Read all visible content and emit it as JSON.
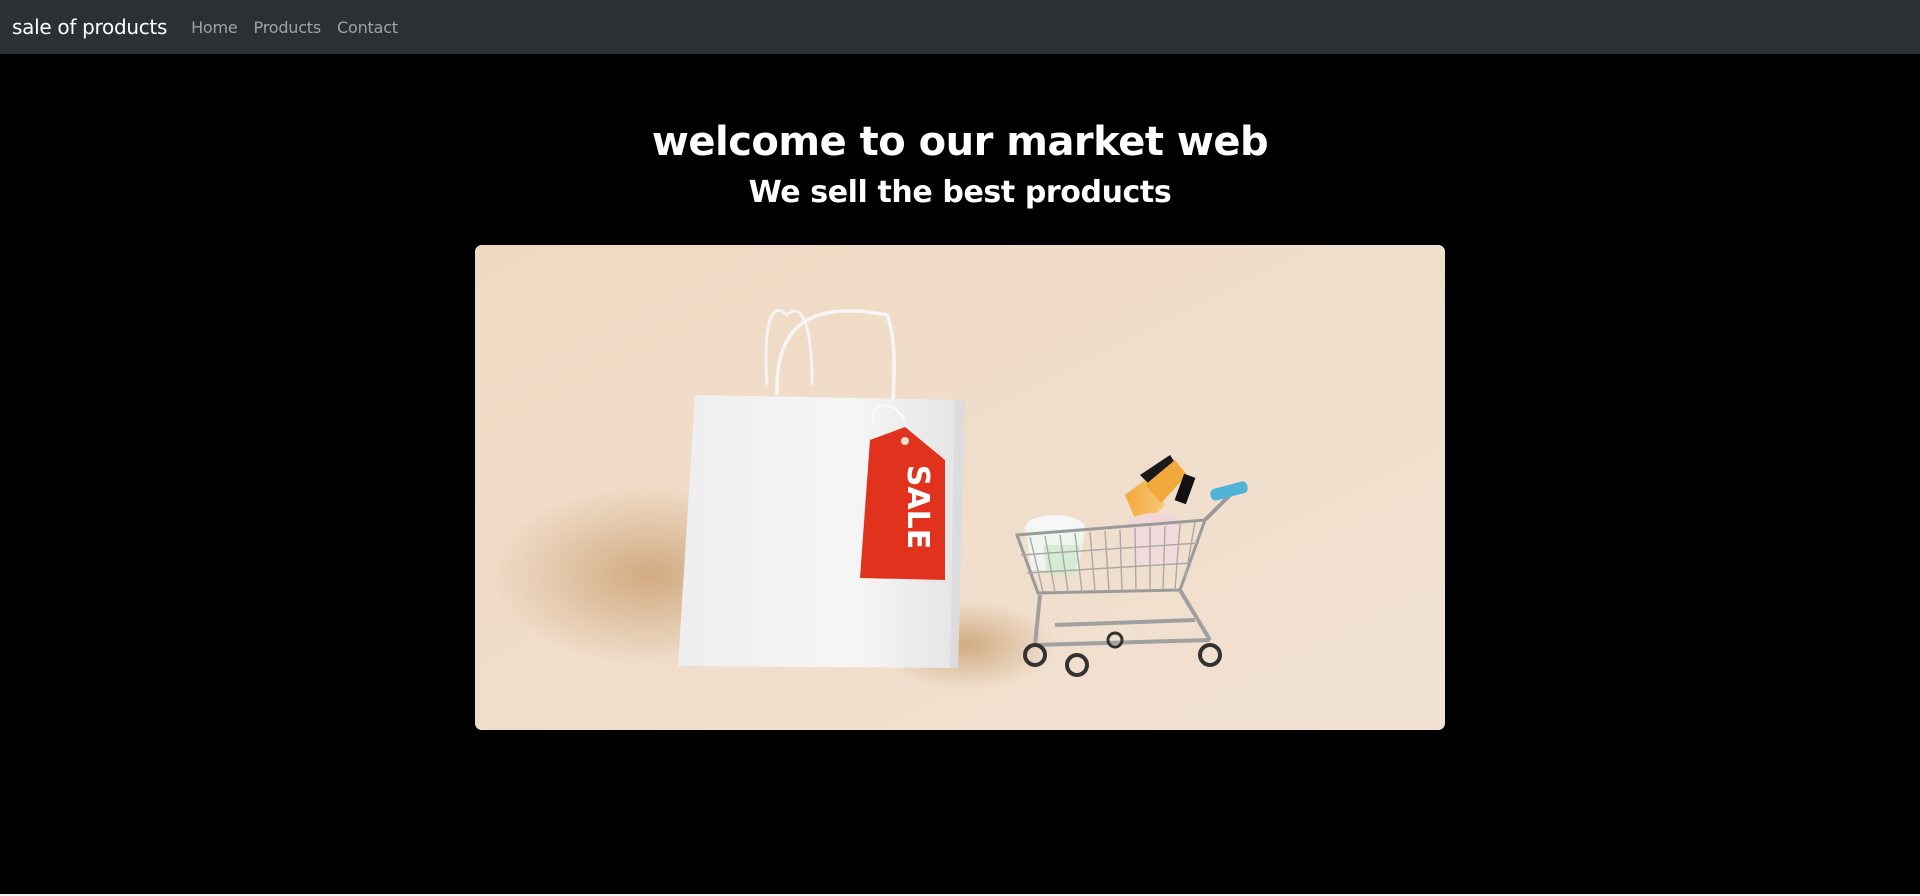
{
  "navbar": {
    "brand": "sale of products",
    "links": [
      "Home",
      "Products",
      "Contact"
    ]
  },
  "hero": {
    "title": "welcome to our market web",
    "subtitle": "We sell the best products",
    "tag_text": "SALE"
  },
  "colors": {
    "navbar_bg": "#2b3035",
    "page_bg": "#000000",
    "tag_red": "#e0321c",
    "backdrop": "#ecd8c3"
  }
}
